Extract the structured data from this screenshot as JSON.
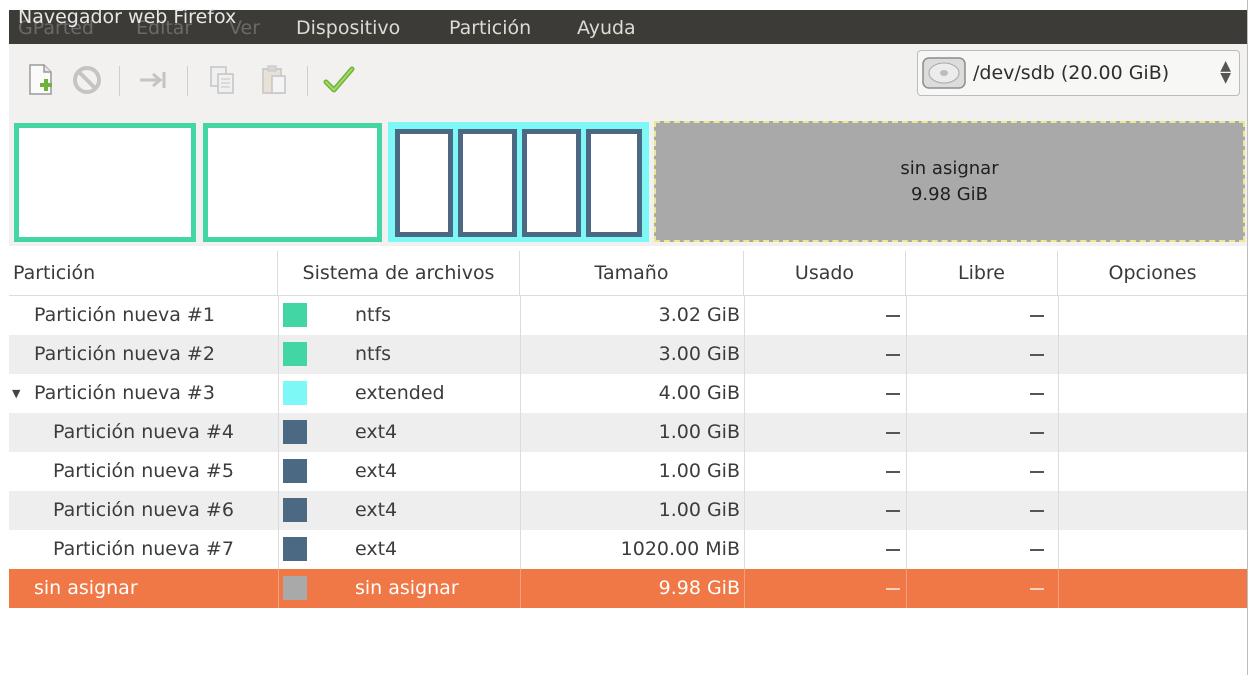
{
  "window_overlay_title": "Navegador web Firefox",
  "menu": [
    "GParted",
    "Editar",
    "Ver",
    "Dispositivo",
    "Partición",
    "Ayuda"
  ],
  "toolbar": {
    "icons": [
      "new-partition-icon",
      "delete-icon",
      "resize-move-icon",
      "copy-icon",
      "paste-icon",
      "apply-icon"
    ]
  },
  "device": {
    "label": "/dev/sdb  (20.00 GiB)",
    "icon": "harddisk-icon"
  },
  "graph": {
    "unallocated_label": "sin asignar",
    "unallocated_size": "9.98 GiB",
    "colors": {
      "ntfs": "#42d6a4",
      "extended": "#7ef7f7",
      "ext4": "#4b6983",
      "unallocated": "#a9a9a9",
      "unallocated_border": "#eaea8a"
    }
  },
  "table": {
    "columns": [
      "Partición",
      "Sistema de archivos",
      "Tamaño",
      "Usado",
      "Libre",
      "Opciones"
    ],
    "rows": [
      {
        "name": "Partición nueva #1",
        "fs": "ntfs",
        "size": "3.02 GiB",
        "used": "---",
        "free": "---",
        "color": "#42d6a4",
        "indent": 0
      },
      {
        "name": "Partición nueva #2",
        "fs": "ntfs",
        "size": "3.00 GiB",
        "used": "---",
        "free": "---",
        "color": "#42d6a4",
        "indent": 0
      },
      {
        "name": "Partición nueva #3",
        "fs": "extended",
        "size": "4.00 GiB",
        "used": "---",
        "free": "---",
        "color": "#7ef7f7",
        "indent": 0,
        "expanded": true
      },
      {
        "name": "Partición nueva #4",
        "fs": "ext4",
        "size": "1.00 GiB",
        "used": "---",
        "free": "---",
        "color": "#4b6983",
        "indent": 1
      },
      {
        "name": "Partición nueva #5",
        "fs": "ext4",
        "size": "1.00 GiB",
        "used": "---",
        "free": "---",
        "color": "#4b6983",
        "indent": 1
      },
      {
        "name": "Partición nueva #6",
        "fs": "ext4",
        "size": "1.00 GiB",
        "used": "---",
        "free": "---",
        "color": "#4b6983",
        "indent": 1
      },
      {
        "name": "Partición nueva #7",
        "fs": "ext4",
        "size": "1020.00 MiB",
        "used": "---",
        "free": "---",
        "color": "#4b6983",
        "indent": 1
      },
      {
        "name": "sin asignar",
        "fs": "sin asignar",
        "size": "9.98 GiB",
        "used": "---",
        "free": "---",
        "color": "#a9a9a9",
        "indent": 0,
        "selected": true
      }
    ]
  }
}
